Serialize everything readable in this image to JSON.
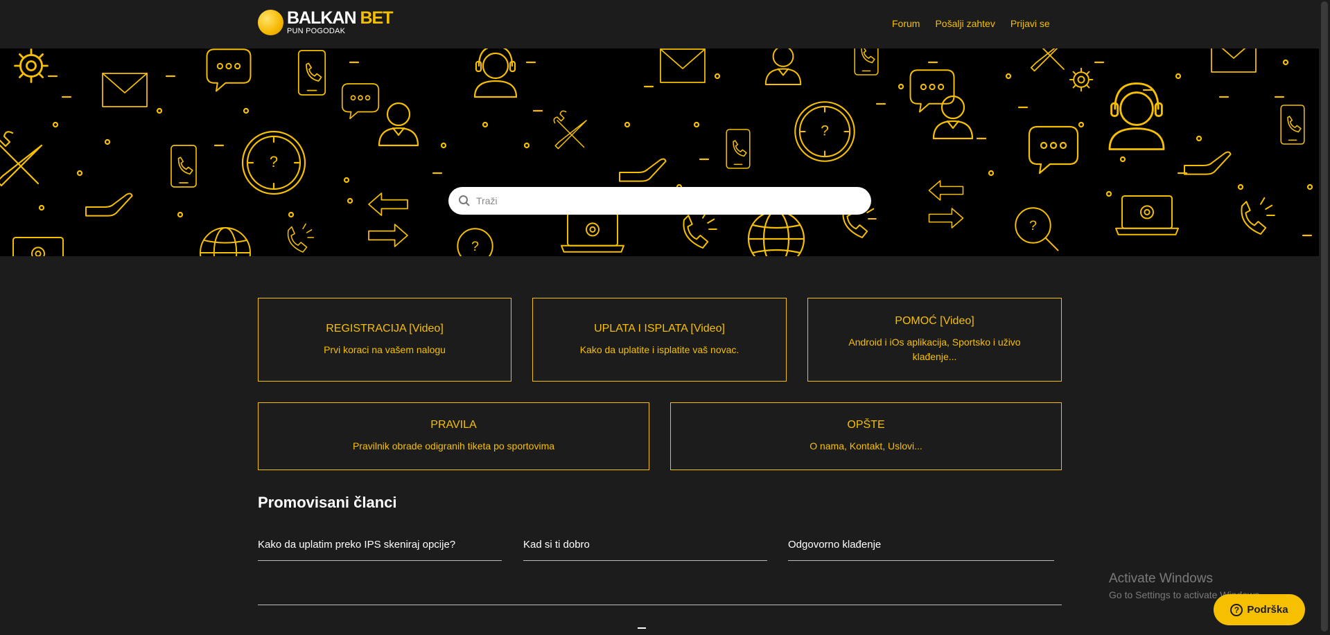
{
  "brand": {
    "name_part1": "BALKAN",
    "name_part2": "BET",
    "tagline": "PUN POGODAK",
    "accent_color": "#f6c000",
    "background_color": "#1c1c1c"
  },
  "nav": {
    "items": [
      {
        "label": "Forum"
      },
      {
        "label": "Pošalji zahtev"
      },
      {
        "label": "Prijavi se"
      }
    ]
  },
  "search": {
    "placeholder": "Traži",
    "icon": "search-icon"
  },
  "categories": [
    {
      "title": "REGISTRACIJA [Video]",
      "description": "Prvi koraci na vašem nalogu"
    },
    {
      "title": "UPLATA I ISPLATA [Video]",
      "description": "Kako da uplatite i isplatite vaš novac."
    },
    {
      "title": "POMOĆ [Video]",
      "description": "Android i iOs aplikacija, Sportsko i uživo klađenje..."
    },
    {
      "title": "PRAVILA",
      "description": "Pravilnik obrade odigranih tiketa po sportovima"
    },
    {
      "title": "OPŠTE",
      "description": "O nama, Kontakt, Uslovi..."
    }
  ],
  "promoted": {
    "title": "Promovisani članci",
    "articles": [
      {
        "label": "Kako da uplatim preko IPS skeniraj opcije?"
      },
      {
        "label": "Kad si ti dobro"
      },
      {
        "label": "Odgovorno klađenje"
      }
    ]
  },
  "watermark": {
    "line1": "Activate Windows",
    "line2": "Go to Settings to activate Windows."
  },
  "support": {
    "label": "Podrška",
    "icon": "help-circle-icon"
  }
}
